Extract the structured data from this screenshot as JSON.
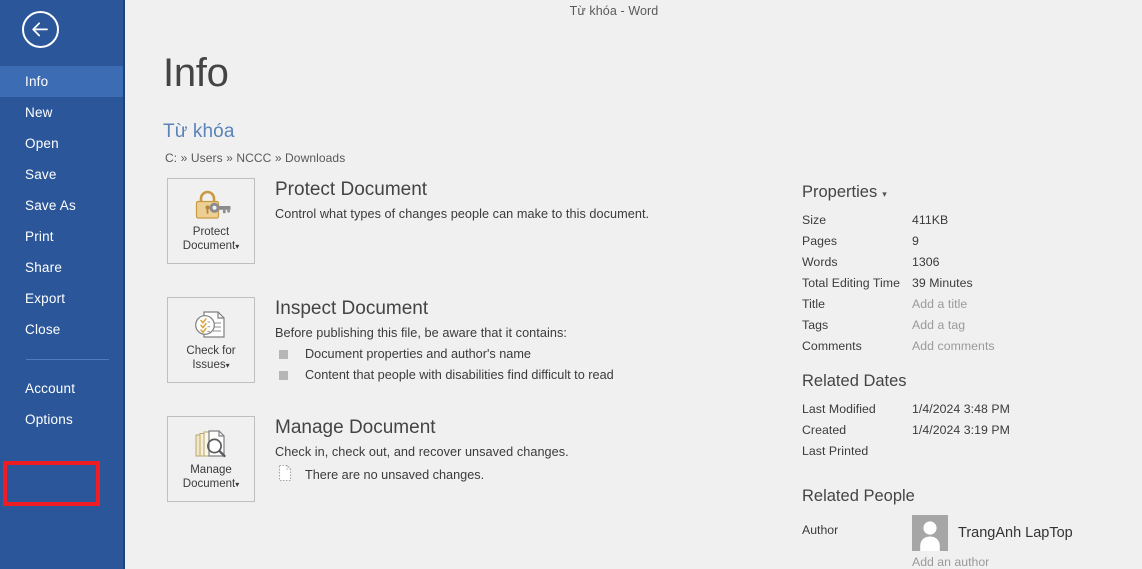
{
  "titlebar": {
    "text": "Từ khóa - Word"
  },
  "sidebar": {
    "back_icon": "back-arrow-icon",
    "items": [
      {
        "label": "Info",
        "selected": true
      },
      {
        "label": "New",
        "selected": false
      },
      {
        "label": "Open",
        "selected": false
      },
      {
        "label": "Save",
        "selected": false
      },
      {
        "label": "Save As",
        "selected": false
      },
      {
        "label": "Print",
        "selected": false
      },
      {
        "label": "Share",
        "selected": false
      },
      {
        "label": "Export",
        "selected": false
      },
      {
        "label": "Close",
        "selected": false
      }
    ],
    "bottom_items": [
      {
        "label": "Account",
        "highlighted": false
      },
      {
        "label": "Options",
        "highlighted": true
      }
    ],
    "highlight_color": "#ee1d24",
    "background_color": "#2b579a",
    "selected_color": "#3c6cb4"
  },
  "main": {
    "page_title": "Info",
    "document_name": "Từ khóa",
    "document_path": "C: » Users » NCCC » Downloads",
    "features": [
      {
        "tile_label_line1": "Protect",
        "tile_label_line2": "Document",
        "tile_caret": "▾",
        "icon": "lock-key-icon",
        "heading": "Protect Document",
        "description": "Control what types of changes people can make to this document.",
        "bullets": []
      },
      {
        "tile_label_line1": "Check for",
        "tile_label_line2": "Issues",
        "tile_caret": "▾",
        "icon": "document-checklist-icon",
        "heading": "Inspect Document",
        "description": "Before publishing this file, be aware that it contains:",
        "bullets": [
          "Document properties and author's name",
          "Content that people with disabilities find difficult to read"
        ]
      },
      {
        "tile_label_line1": "Manage",
        "tile_label_line2": "Document",
        "tile_caret": "▾",
        "icon": "documents-magnifier-icon",
        "heading": "Manage Document",
        "description": "Check in, check out, and recover unsaved changes.",
        "note_icon": "dotted-document-icon",
        "note": "There are no unsaved changes."
      }
    ]
  },
  "properties": {
    "heading": "Properties",
    "caret": "▾",
    "rows": [
      {
        "key": "Size",
        "value": "411KB",
        "placeholder": false
      },
      {
        "key": "Pages",
        "value": "9",
        "placeholder": false
      },
      {
        "key": "Words",
        "value": "1306",
        "placeholder": false
      },
      {
        "key": "Total Editing Time",
        "value": "39 Minutes",
        "placeholder": false
      },
      {
        "key": "Title",
        "value": "Add a title",
        "placeholder": true
      },
      {
        "key": "Tags",
        "value": "Add a tag",
        "placeholder": true
      },
      {
        "key": "Comments",
        "value": "Add comments",
        "placeholder": true
      }
    ]
  },
  "related_dates": {
    "heading": "Related Dates",
    "rows": [
      {
        "key": "Last Modified",
        "value": "1/4/2024 3:48 PM"
      },
      {
        "key": "Created",
        "value": "1/4/2024 3:19 PM"
      },
      {
        "key": "Last Printed",
        "value": ""
      }
    ]
  },
  "related_people": {
    "heading": "Related People",
    "author_label": "Author",
    "author_name": "TrangAnh LapTop",
    "avatar_icon": "person-avatar-icon",
    "add_author": "Add an author"
  }
}
